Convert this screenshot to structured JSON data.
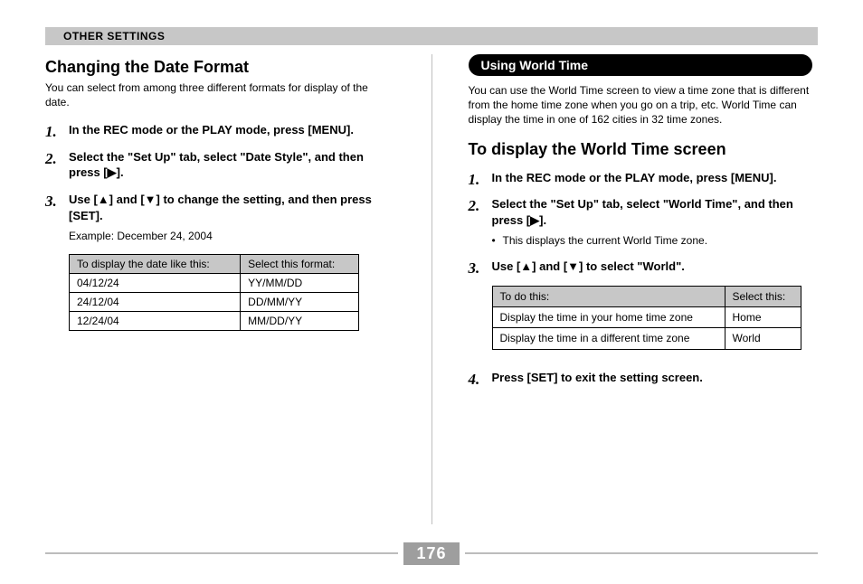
{
  "section_bar": "OTHER SETTINGS",
  "left": {
    "heading": "Changing the Date Format",
    "intro": "You can select from among three different formats for display of the date.",
    "steps": [
      "In the REC mode or the PLAY mode, press [MENU].",
      "Select the \"Set Up\" tab, select \"Date Style\", and then press [▶].",
      "Use [▲] and [▼] to change the setting, and then press [SET]."
    ],
    "example_label": "Example: December 24, 2004",
    "table": {
      "headers": [
        "To display the date like this:",
        "Select this format:"
      ],
      "rows": [
        [
          "04/12/24",
          "YY/MM/DD"
        ],
        [
          "24/12/04",
          "DD/MM/YY"
        ],
        [
          "12/24/04",
          "MM/DD/YY"
        ]
      ]
    }
  },
  "right": {
    "pill": "Using World Time",
    "intro": "You can use the World Time screen to view a time zone that is different from the home time zone when you go on a trip, etc. World Time can display the time in one of 162 cities in 32 time zones.",
    "heading": "To display the World Time screen",
    "steps": [
      "In the REC mode or the PLAY mode, press [MENU].",
      "Select the \"Set Up\" tab, select \"World Time\", and then press [▶].",
      "Use [▲] and [▼] to select \"World\".",
      "Press [SET] to exit the setting screen."
    ],
    "step2_bullet": "This displays the current World Time zone.",
    "table": {
      "headers": [
        "To do this:",
        "Select this:"
      ],
      "rows": [
        [
          "Display the time in your home time zone",
          "Home"
        ],
        [
          "Display the time in a different time zone",
          "World"
        ]
      ]
    }
  },
  "page_number": "176"
}
